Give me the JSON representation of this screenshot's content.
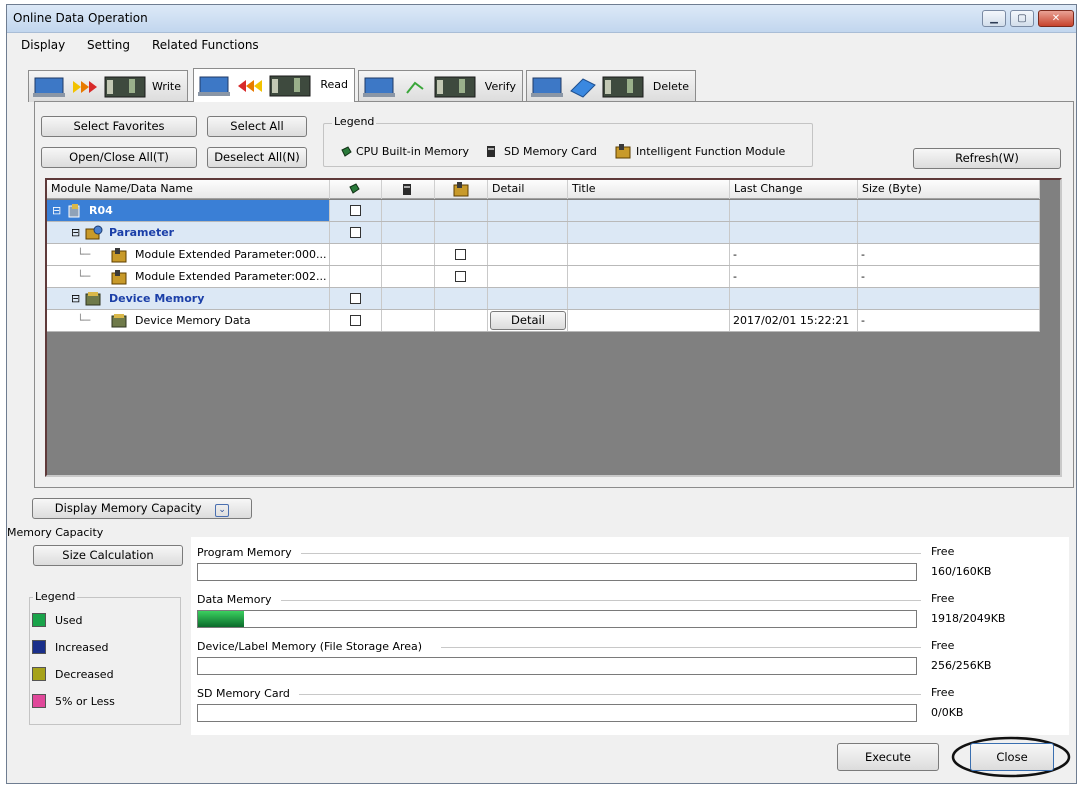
{
  "window": {
    "title": "Online Data Operation"
  },
  "menu": [
    "Display",
    "Setting",
    "Related Functions"
  ],
  "tabs": [
    {
      "label": "Write",
      "active": false
    },
    {
      "label": "Read",
      "active": true
    },
    {
      "label": "Verify",
      "active": false
    },
    {
      "label": "Delete",
      "active": false
    }
  ],
  "buttons": {
    "select_favorites": "Select Favorites",
    "select_all": "Select All",
    "open_close_all": "Open/Close All(T)",
    "deselect_all": "Deselect All(N)",
    "refresh": "Refresh(W)",
    "display_memory_capacity": "Display Memory Capacity",
    "size_calculation": "Size Calculation",
    "execute": "Execute",
    "close": "Close"
  },
  "legend": {
    "title": "Legend",
    "items": [
      "CPU Built-in Memory",
      "SD Memory Card",
      "Intelligent Function Module"
    ]
  },
  "grid": {
    "headers": [
      "Module Name/Data Name",
      "",
      "",
      "",
      "Detail",
      "Title",
      "Last Change",
      "Size (Byte)"
    ],
    "rows": [
      {
        "name": "R04",
        "cpu": true,
        "sd": false,
        "ifm": false,
        "detail": "",
        "title": "",
        "last_change": "",
        "size": ""
      },
      {
        "name": "Parameter",
        "cpu": true,
        "sd": false,
        "ifm": false,
        "detail": "",
        "title": "",
        "last_change": "",
        "size": ""
      },
      {
        "name": "Module Extended Parameter:000...",
        "cpu": false,
        "sd": false,
        "ifm": true,
        "detail": "",
        "title": "",
        "last_change": "-",
        "size": "-"
      },
      {
        "name": "Module Extended Parameter:002...",
        "cpu": false,
        "sd": false,
        "ifm": true,
        "detail": "",
        "title": "",
        "last_change": "-",
        "size": "-"
      },
      {
        "name": "Device Memory",
        "cpu": true,
        "sd": false,
        "ifm": false,
        "detail": "",
        "title": "",
        "last_change": "",
        "size": ""
      },
      {
        "name": "Device Memory Data",
        "cpu": true,
        "sd": false,
        "ifm": false,
        "detail": "Detail",
        "title": "",
        "last_change": "2017/02/01 15:22:21",
        "size": "-"
      }
    ]
  },
  "memory": {
    "section_label": "Memory Capacity",
    "legend_title": "Legend",
    "legend": [
      {
        "label": "Used",
        "color": "#1aa34a"
      },
      {
        "label": "Increased",
        "color": "#1a2f8a"
      },
      {
        "label": "Decreased",
        "color": "#a6a21a"
      },
      {
        "label": "5% or Less",
        "color": "#e0489a"
      }
    ],
    "free_label": "Free",
    "items": [
      {
        "name": "Program Memory",
        "value": "160/160KB",
        "used_fraction": 0.0
      },
      {
        "name": "Data Memory",
        "value": "1918/2049KB",
        "used_fraction": 0.064
      },
      {
        "name": "Device/Label Memory (File Storage Area)",
        "value": "256/256KB",
        "used_fraction": 0.0
      },
      {
        "name": "SD Memory Card",
        "value": "0/0KB",
        "used_fraction": 0.0
      }
    ]
  }
}
